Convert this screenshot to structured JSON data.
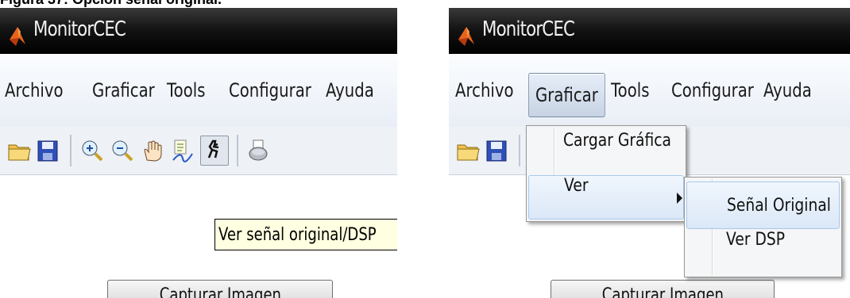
{
  "caption": "Figura 37: Opción señal original.",
  "app": {
    "title": "MonitorCEC"
  },
  "menu": [
    {
      "label": "Archivo"
    },
    {
      "label": "Graficar"
    },
    {
      "label": "Tools"
    },
    {
      "label": "Configurar"
    },
    {
      "label": "Ayuda"
    }
  ],
  "toolbar_icons": [
    "open-folder-icon",
    "save-icon",
    "zoom-in-icon",
    "zoom-out-icon",
    "pan-hand-icon",
    "data-cursor-icon",
    "signal-view-icon",
    "print-icon"
  ],
  "left": {
    "tooltip": "Ver señal original/DSP",
    "button_label": "Capturar Imagen"
  },
  "right": {
    "graficar_menu": [
      {
        "label": "Cargar Gráfica"
      },
      {
        "label": "Ver"
      }
    ],
    "ver_submenu": [
      {
        "label": "Señal Original"
      },
      {
        "label": "Ver DSP"
      }
    ],
    "button_label": "Capturar Imagen"
  },
  "colors": {
    "titlebar": "#000000",
    "menubar": "#f4f7fb",
    "tooltip_bg": "#ffffe1",
    "menu_highlight": "#dbe8f7"
  }
}
